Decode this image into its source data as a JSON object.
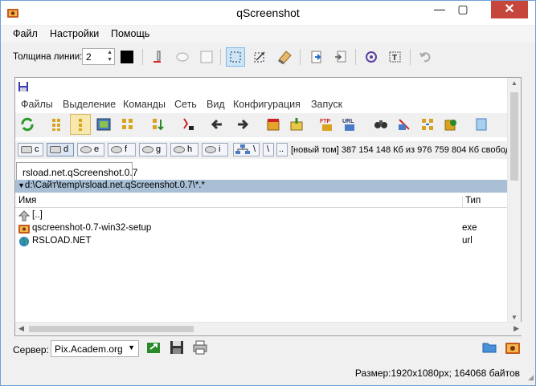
{
  "window": {
    "title": "qScreenshot"
  },
  "menu": [
    "Файл",
    "Настройки",
    "Помощь"
  ],
  "toolbar": {
    "line_width_label": "Толщина линии:",
    "line_width_value": "2"
  },
  "tc": {
    "menu": [
      "Файлы",
      "Выделение",
      "Команды",
      "Сеть",
      "Вид",
      "Конфигурация",
      "Запуск"
    ],
    "drives": [
      "c",
      "d",
      "e",
      "f",
      "g",
      "h",
      "i"
    ],
    "drive_extra": [
      "\\",
      ".."
    ],
    "disk_info": "[новый том]  387 154 148 Кб из 976 759 804 Кб свобод",
    "tab_label": "rsload.net.qScreenshot.0.7",
    "path": "d:\\Сайт\\temp\\rsload.net.qScreenshot.0.7\\*.*",
    "columns": {
      "name": "Имя",
      "type": "Тип"
    },
    "files": [
      {
        "name": "[..]",
        "type": ""
      },
      {
        "name": "qscreenshot-0.7-win32-setup",
        "type": "exe"
      },
      {
        "name": "RSLOAD.NET",
        "type": "url"
      }
    ]
  },
  "server": {
    "label": "Сервер:",
    "value": "Pix.Academ.org"
  },
  "status": {
    "text": "Размер:1920x1080px; 164068 байтов"
  },
  "colors": {
    "accent": "#3399ff",
    "close": "#c7463c",
    "path_bg": "#a8bfd6"
  }
}
